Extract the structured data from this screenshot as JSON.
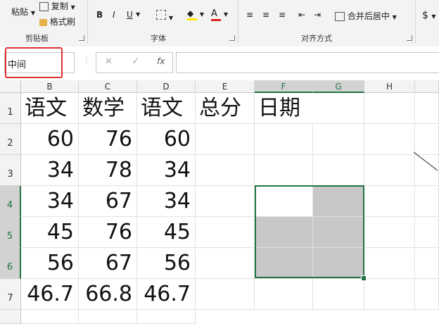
{
  "ribbon": {
    "paste_label": "粘贴",
    "copy_label": "复制",
    "format_painter_label": "格式刷",
    "clipboard_group": "剪贴板",
    "font_group": "字体",
    "alignment_group": "对齐方式",
    "bold": "B",
    "italic": "I",
    "underline": "U",
    "merge_center_label": "合并后居中",
    "currency_symbol": "$"
  },
  "formula_bar": {
    "name_box_value": "中间",
    "cancel_icon": "✕",
    "enter_icon": "✓",
    "fx_label": "fx",
    "formula_value": ""
  },
  "columns": [
    "B",
    "C",
    "D",
    "E",
    "F",
    "G",
    "H"
  ],
  "rows": [
    "1",
    "2",
    "3",
    "4",
    "5",
    "6",
    "7"
  ],
  "cells": {
    "r1": [
      "语文",
      "数学",
      "语文",
      "总分",
      "日期",
      "",
      ""
    ],
    "r2": [
      "60",
      "76",
      "60",
      "",
      "",
      "",
      ""
    ],
    "r3": [
      "34",
      "78",
      "34",
      "",
      "",
      "",
      ""
    ],
    "r4": [
      "34",
      "67",
      "34",
      "",
      "",
      "",
      ""
    ],
    "r5": [
      "45",
      "76",
      "45",
      "",
      "",
      "",
      ""
    ],
    "r6": [
      "56",
      "67",
      "56",
      "",
      "",
      "",
      ""
    ],
    "r7": [
      "46.7",
      "66.8",
      "46.7",
      "",
      "",
      "",
      ""
    ]
  },
  "colors": {
    "selection_border": "#217346",
    "highlight_box": "#e03030",
    "merged_fill": "#c8c8c8"
  }
}
